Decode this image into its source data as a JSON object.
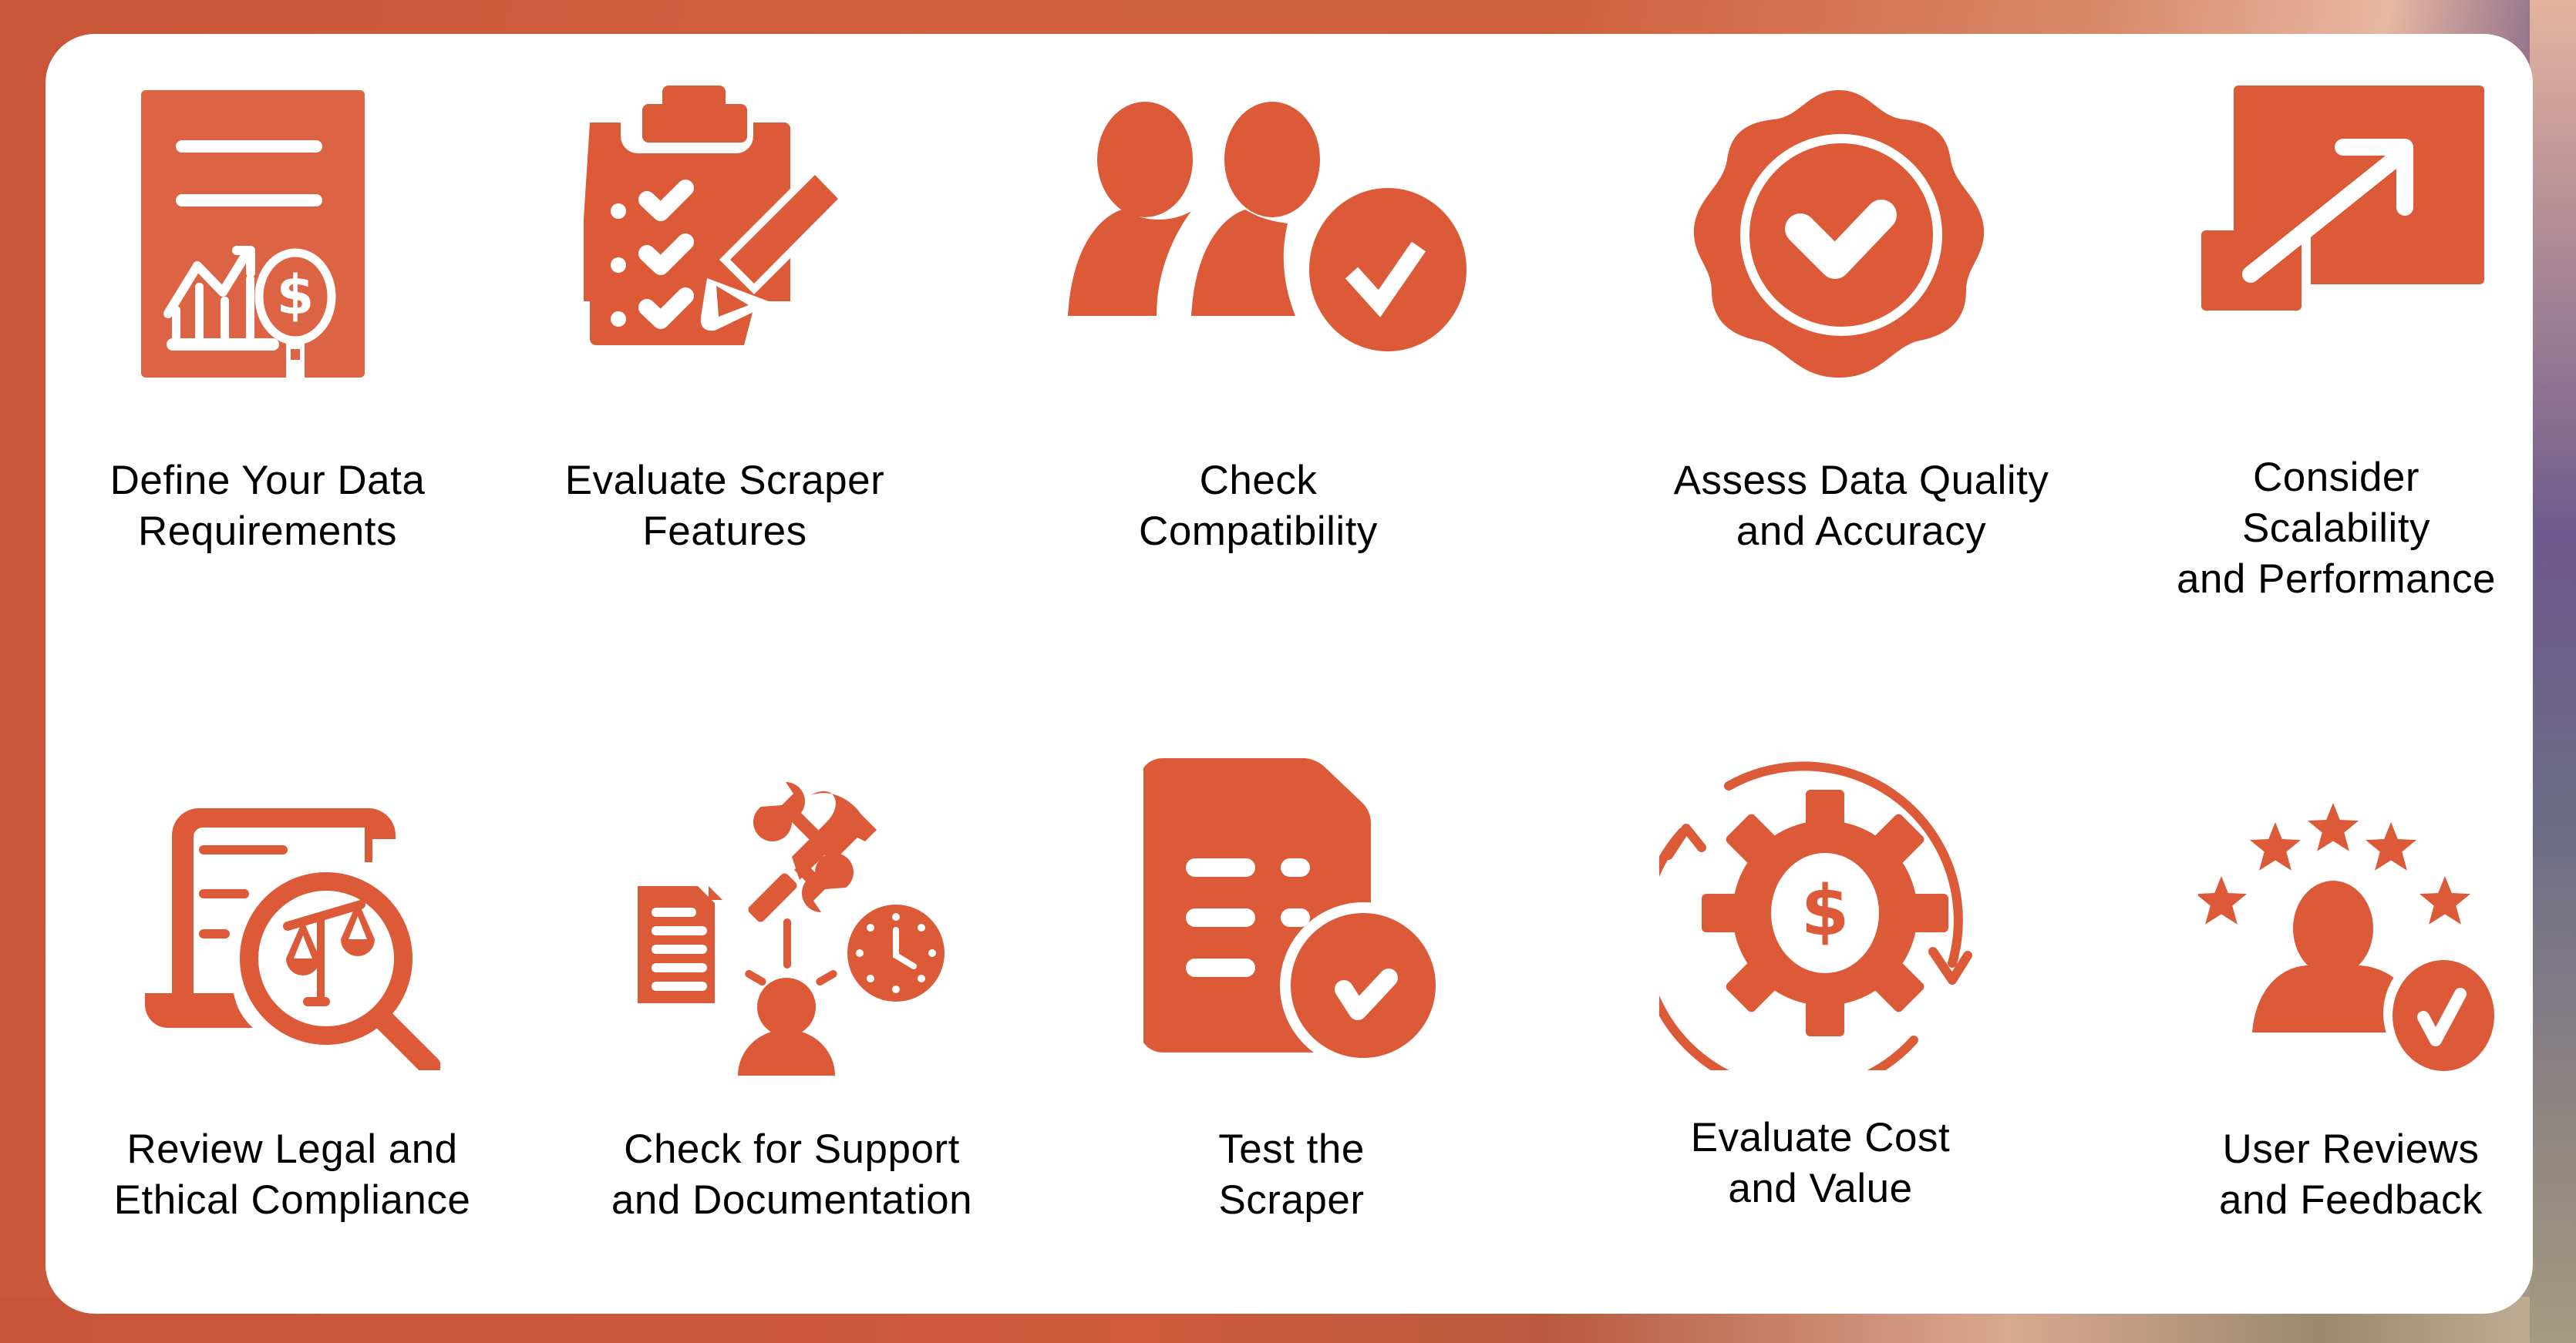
{
  "accent_color": "#dc5a38",
  "items": [
    {
      "icon": "document-chart-dollar-icon",
      "lines": [
        "Define Your Data",
        "Requirements"
      ]
    },
    {
      "icon": "clipboard-checklist-pencil-icon",
      "lines": [
        "Evaluate Scraper",
        "Features"
      ]
    },
    {
      "icon": "users-check-icon",
      "lines": [
        "Check",
        "Compatibility"
      ]
    },
    {
      "icon": "badge-check-icon",
      "lines": [
        "Assess Data Quality",
        "and Accuracy"
      ]
    },
    {
      "icon": "scale-up-arrow-icon",
      "lines": [
        "Consider",
        "Scalability",
        "and Performance"
      ]
    },
    {
      "icon": "legal-document-scale-magnifier-icon",
      "lines": [
        "Review Legal and",
        "Ethical Compliance"
      ]
    },
    {
      "icon": "support-tools-clock-person-icon",
      "lines": [
        "Check for Support",
        "and Documentation"
      ]
    },
    {
      "icon": "document-check-icon",
      "lines": [
        "Test the",
        "Scraper"
      ]
    },
    {
      "icon": "gear-dollar-cycle-icon",
      "lines": [
        "Evaluate Cost",
        "and Value"
      ]
    },
    {
      "icon": "user-stars-check-icon",
      "lines": [
        "User Reviews",
        "and Feedback"
      ]
    }
  ]
}
